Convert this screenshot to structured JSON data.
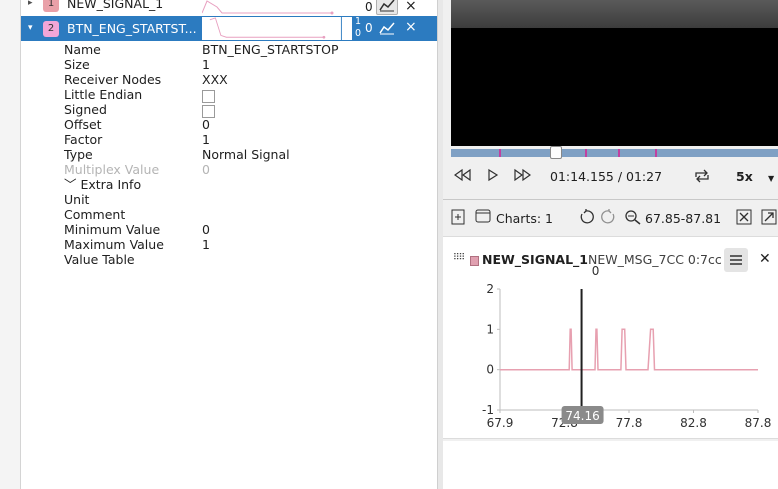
{
  "signals": [
    {
      "index": "1",
      "name": "NEW_SIGNAL_1",
      "value": "0",
      "badge_color": "#e9a0a8",
      "close": "×",
      "expand": "▸"
    },
    {
      "index": "2",
      "name": "BTN_ENG_STARTST...",
      "value": "0",
      "badge_color": "#f2a6d8",
      "close": "×",
      "expand": "▾",
      "max": "1",
      "min": "0"
    }
  ],
  "properties": [
    {
      "key": "Name",
      "value": "BTN_ENG_STARTSTOP"
    },
    {
      "key": "Size",
      "value": "1"
    },
    {
      "key": "Receiver Nodes",
      "value": "XXX"
    },
    {
      "key": "Little Endian",
      "value": ""
    },
    {
      "key": "Signed",
      "value": ""
    },
    {
      "key": "Offset",
      "value": "0"
    },
    {
      "key": "Factor",
      "value": "1"
    },
    {
      "key": "Type",
      "value": "Normal Signal"
    },
    {
      "key": "Multiplex Value",
      "value": "0"
    },
    {
      "key": "﹀ Extra Info",
      "value": ""
    },
    {
      "key": "Unit",
      "value": ""
    },
    {
      "key": "Comment",
      "value": ""
    },
    {
      "key": "Minimum Value",
      "value": "0"
    },
    {
      "key": "Maximum Value",
      "value": "1"
    },
    {
      "key": "Value Table",
      "value": ""
    }
  ],
  "playback": {
    "time": "01:14.155 / 01:27",
    "speed": "5x",
    "progress": 0.31
  },
  "charts_toolbar": {
    "charts_count": "Charts: 1",
    "range": "67.85-87.81"
  },
  "chart_data": {
    "type": "line",
    "title": "NEW_SIGNAL_1",
    "subtitle": "NEW_MSG_7CC 0:7cc",
    "cursor_label": "0",
    "cursor_x": 74.16,
    "cursor_x_label": "74.16",
    "x_ticks": [
      "67.9",
      "72.8",
      "77.8",
      "82.8",
      "87.8"
    ],
    "y_ticks": [
      "2",
      "1",
      "0",
      "-1"
    ],
    "xlim": [
      67.85,
      87.81
    ],
    "ylim": [
      -1,
      2
    ],
    "color": "#e7a0b0",
    "series": [
      {
        "x": [
          67.85,
          73.2,
          73.28,
          73.35,
          73.43,
          75.2,
          75.28,
          75.35,
          75.43,
          77.2,
          77.3,
          77.5,
          77.6,
          79.3,
          79.5,
          79.7,
          79.8,
          87.81
        ],
        "y": [
          0,
          0,
          1,
          1,
          0,
          0,
          1,
          1,
          0,
          0,
          1,
          1,
          0,
          0,
          1,
          1,
          0,
          0
        ]
      }
    ]
  }
}
